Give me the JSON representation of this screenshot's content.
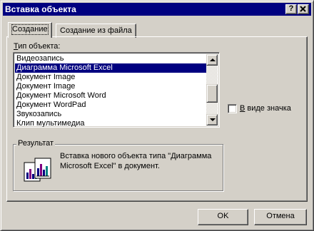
{
  "window": {
    "title": "Вставка объекта",
    "help_button": "?",
    "close_button": "×"
  },
  "tabs": [
    {
      "label": "Создание",
      "active": true
    },
    {
      "label": "Создание из файла",
      "active": false
    }
  ],
  "object_type": {
    "label": "Тип объекта:",
    "items": [
      "Видеозапись",
      "Диаграмма Microsoft Excel",
      "Документ Image",
      "Документ Image",
      "Документ Microsoft Word",
      "Документ WordPad",
      "Звукозапись",
      "Клип мультимедиа"
    ],
    "selected_index": 1
  },
  "display_as_icon": {
    "label_first": "В",
    "label_rest": " виде значка",
    "checked": false
  },
  "result": {
    "title": "Результат",
    "text": "Вставка нового объекта типа \"Диаграмма Microsoft Excel\" в документ.",
    "icon": "chart-icon"
  },
  "buttons": {
    "ok": "OK",
    "cancel": "Отмена"
  },
  "colors": {
    "titlebar": "#000080",
    "face": "#d4d0c8",
    "selection": "#000080"
  }
}
